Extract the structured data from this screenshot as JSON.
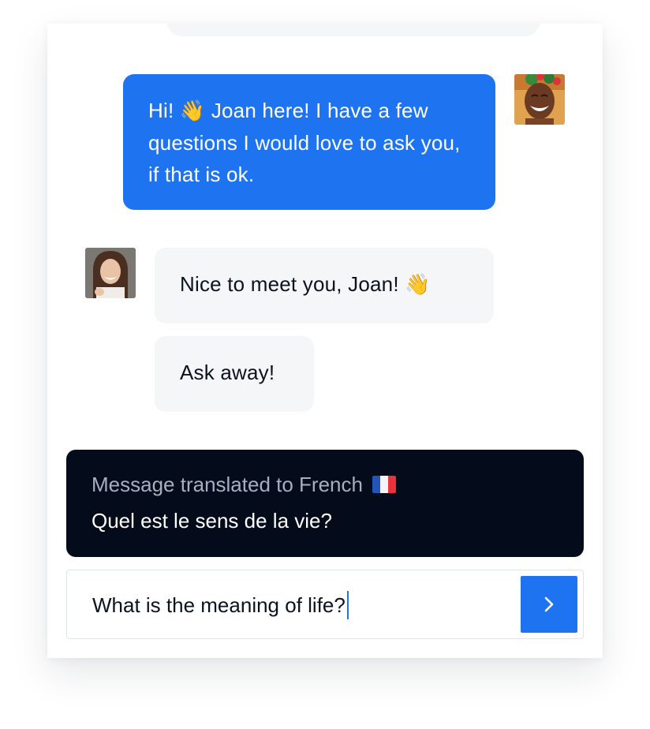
{
  "colors": {
    "accent": "#1e74f0",
    "incoming_bubble": "#f5f6f8",
    "translation_panel": "#040c1b",
    "translation_label": "#a6afc0"
  },
  "conversation": {
    "outgoing_message": {
      "sender": "Joan",
      "avatar_icon": "joan-avatar",
      "text_before_emoji": "Hi! ",
      "emoji": "👋",
      "text_after_emoji": " Joan here! I have a few questions I would love to ask you, if that is ok."
    },
    "incoming_messages": [
      {
        "text": "Nice to meet you, Joan! ",
        "emoji": "👋"
      },
      {
        "text": "Ask away!",
        "emoji": ""
      }
    ],
    "incoming_avatar_icon": "agent-avatar"
  },
  "translation": {
    "label": "Message translated to French",
    "flag_icon": "france-flag-icon",
    "text": "Quel est le sens de la vie?"
  },
  "composer": {
    "value": "What is the meaning of life?",
    "send_icon": "chevron-right-icon"
  }
}
